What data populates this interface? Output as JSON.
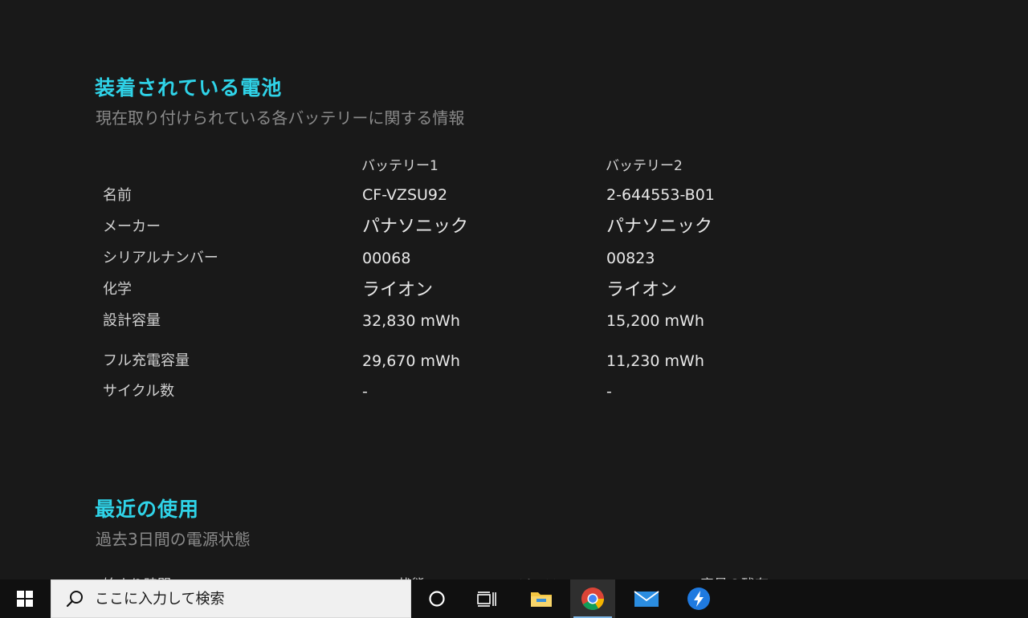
{
  "installed": {
    "title": "装着されている電池",
    "subtitle": "現在取り付けられている各バッテリーに関する情報",
    "columns": [
      "バッテリー1",
      "バッテリー2"
    ],
    "rows": [
      {
        "label": "名前",
        "values": [
          "CF-VZSU92",
          "2-644553-B01"
        ]
      },
      {
        "label": "メーカー",
        "values": [
          "パナソニック",
          "パナソニック"
        ]
      },
      {
        "label": "シリアルナンバー",
        "values": [
          "00068",
          "00823"
        ]
      },
      {
        "label": "化学",
        "values": [
          "ライオン",
          "ライオン"
        ]
      },
      {
        "label": "設計容量",
        "values": [
          "32,830 mWh",
          "15,200 mWh"
        ]
      },
      {
        "label": "フル充電容量",
        "values": [
          "29,670 mWh",
          "11,230 mWh"
        ]
      },
      {
        "label": "サイクル数",
        "values": [
          "-",
          "-"
        ]
      }
    ]
  },
  "recent": {
    "title": "最近の使用",
    "subtitle": "過去3日間の電源状態",
    "columns_cut": [
      "始まり時間",
      "状態",
      "ソース",
      "容量の残存"
    ]
  },
  "taskbar": {
    "search_placeholder": "ここに入力して検索",
    "apps": [
      "cortana-icon",
      "task-view-icon",
      "file-explorer-icon",
      "chrome-icon",
      "mail-icon",
      "messenger-icon"
    ]
  },
  "colors": {
    "accent": "#2fd3e8",
    "background": "#191919",
    "taskbar": "#101010"
  }
}
